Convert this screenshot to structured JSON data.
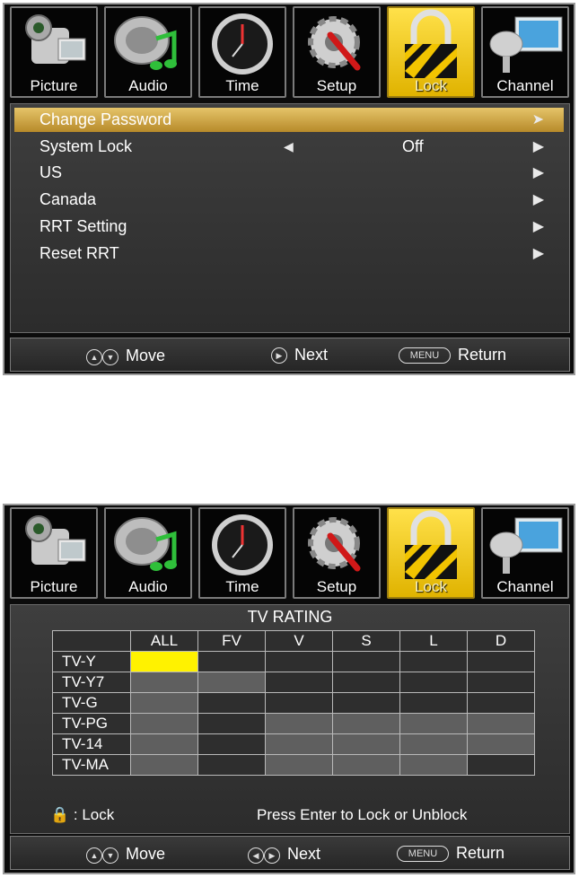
{
  "tabs": [
    {
      "label": "Picture",
      "icon": "camcorder-icon"
    },
    {
      "label": "Audio",
      "icon": "speaker-note-icon"
    },
    {
      "label": "Time",
      "icon": "clock-icon"
    },
    {
      "label": "Setup",
      "icon": "gear-screwdriver-icon"
    },
    {
      "label": "Lock",
      "icon": "padlock-icon",
      "active": true
    },
    {
      "label": "Channel",
      "icon": "satellite-monitor-icon"
    }
  ],
  "lock_menu": {
    "items": [
      {
        "label": "Change Password",
        "selected": true
      },
      {
        "label": "System Lock",
        "value": "Off"
      },
      {
        "label": "US"
      },
      {
        "label": "Canada"
      },
      {
        "label": "RRT Setting"
      },
      {
        "label": "Reset RRT"
      }
    ]
  },
  "footer1": {
    "move": "Move",
    "next": "Next",
    "menu_key": "MENU",
    "return": "Return"
  },
  "tv_rating": {
    "title": "TV RATING",
    "columns": [
      "ALL",
      "FV",
      "V",
      "S",
      "L",
      "D"
    ],
    "rows": [
      "TV-Y",
      "TV-Y7",
      "TV-G",
      "TV-PG",
      "TV-14",
      "TV-MA"
    ],
    "lock_label": ": Lock",
    "hint": "Press Enter to Lock or Unblock"
  },
  "footer2": {
    "move": "Move",
    "next": "Next",
    "menu_key": "MENU",
    "return": "Return"
  },
  "colors": {
    "selection": "#d8b04a",
    "cursor_cell": "#fff200",
    "active_tab": "#f5c800"
  }
}
